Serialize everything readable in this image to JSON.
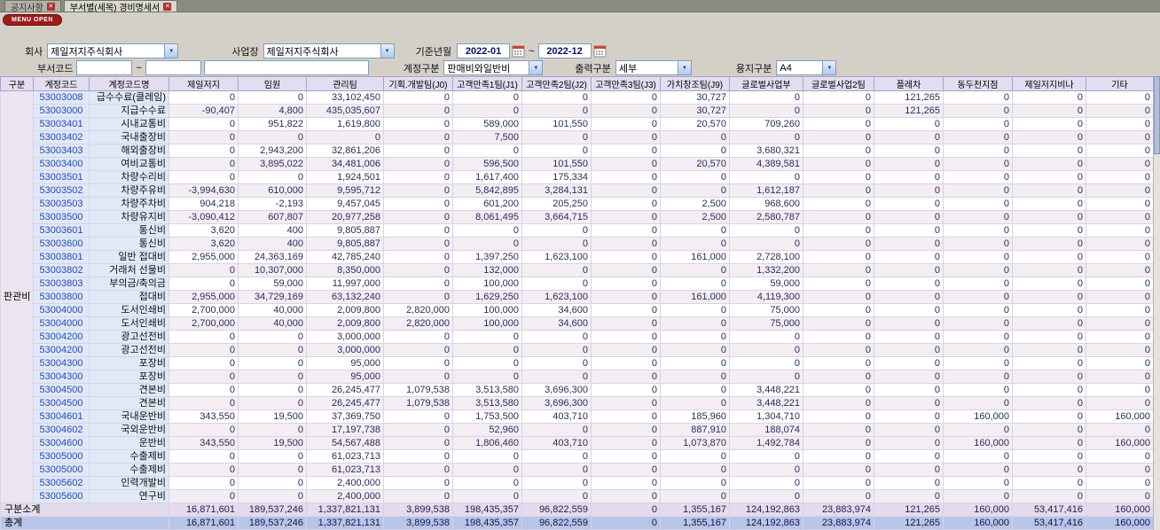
{
  "tabs": [
    {
      "label": "공지사항"
    },
    {
      "label": "부서별(세목) 경비명세서"
    }
  ],
  "menu_button": "MENU OPEN",
  "filters": {
    "company": {
      "label": "회사",
      "value": "제일저지주식회사"
    },
    "workplace": {
      "label": "사업장",
      "value": "제일저지주식회사"
    },
    "period": {
      "label": "기준년월",
      "from": "2022-01",
      "to": "2022-12",
      "separator": "~"
    },
    "dept_code": {
      "label": "부서코드",
      "value1": "",
      "value2": "",
      "value3": "",
      "separator": "~"
    },
    "account_type": {
      "label": "계정구분",
      "value": "판매비와일반비"
    },
    "output_type": {
      "label": "출력구분",
      "value": "세부"
    },
    "paper_type": {
      "label": "용지구분",
      "value": "A4"
    }
  },
  "grid": {
    "columns": [
      "구분",
      "계정코드",
      "계정코드명",
      "제일저지",
      "임원",
      "관리팀",
      "기획.개발팀(J0)",
      "고객만족1팀(J1)",
      "고객만족2팀(J2)",
      "고객만족3팀(J3)",
      "가치창조팀(J9)",
      "글로벌사업부",
      "글로벌사업2팀",
      "플레차",
      "동두천지점",
      "제일저지비나",
      "기타"
    ],
    "group_label": "판관비",
    "rows": [
      {
        "code": "53003008",
        "name": "급수수료(클레임)",
        "shade": "w",
        "values": [
          "0",
          "0",
          "33,102,450",
          "0",
          "0",
          "0",
          "0",
          "30,727",
          "0",
          "0",
          "121,265",
          "0",
          "0",
          "0"
        ]
      },
      {
        "code": "53003000",
        "name": "지급수수료",
        "shade": "p",
        "values": [
          "-90,407",
          "4,800",
          "435,035,607",
          "0",
          "0",
          "0",
          "0",
          "30,727",
          "0",
          "0",
          "121,265",
          "0",
          "0",
          "0"
        ]
      },
      {
        "code": "53003401",
        "name": "시내교통비",
        "shade": "w",
        "values": [
          "0",
          "951,822",
          "1,619,800",
          "0",
          "589,000",
          "101,550",
          "0",
          "20,570",
          "709,260",
          "0",
          "0",
          "0",
          "0",
          "0"
        ]
      },
      {
        "code": "53003402",
        "name": "국내출장비",
        "shade": "p",
        "values": [
          "0",
          "0",
          "0",
          "0",
          "7,500",
          "0",
          "0",
          "0",
          "0",
          "0",
          "0",
          "0",
          "0",
          "0"
        ]
      },
      {
        "code": "53003403",
        "name": "해외출장비",
        "shade": "w",
        "values": [
          "0",
          "2,943,200",
          "32,861,206",
          "0",
          "0",
          "0",
          "0",
          "0",
          "3,680,321",
          "0",
          "0",
          "0",
          "0",
          "0"
        ]
      },
      {
        "code": "53003400",
        "name": "여비교통비",
        "shade": "p",
        "values": [
          "0",
          "3,895,022",
          "34,481,006",
          "0",
          "596,500",
          "101,550",
          "0",
          "20,570",
          "4,389,581",
          "0",
          "0",
          "0",
          "0",
          "0"
        ]
      },
      {
        "code": "53003501",
        "name": "차량수리비",
        "shade": "w",
        "values": [
          "0",
          "0",
          "1,924,501",
          "0",
          "1,617,400",
          "175,334",
          "0",
          "0",
          "0",
          "0",
          "0",
          "0",
          "0",
          "0"
        ]
      },
      {
        "code": "53003502",
        "name": "차량주유비",
        "shade": "p",
        "values": [
          "-3,994,630",
          "610,000",
          "9,595,712",
          "0",
          "5,842,895",
          "3,284,131",
          "0",
          "0",
          "1,612,187",
          "0",
          "0",
          "0",
          "0",
          "0"
        ]
      },
      {
        "code": "53003503",
        "name": "차량주차비",
        "shade": "w",
        "values": [
          "904,218",
          "-2,193",
          "9,457,045",
          "0",
          "601,200",
          "205,250",
          "0",
          "2,500",
          "968,600",
          "0",
          "0",
          "0",
          "0",
          "0"
        ]
      },
      {
        "code": "53003500",
        "name": "차량유지비",
        "shade": "p",
        "values": [
          "-3,090,412",
          "607,807",
          "20,977,258",
          "0",
          "8,061,495",
          "3,664,715",
          "0",
          "2,500",
          "2,580,787",
          "0",
          "0",
          "0",
          "0",
          "0"
        ]
      },
      {
        "code": "53003601",
        "name": "통신비",
        "shade": "w",
        "values": [
          "3,620",
          "400",
          "9,805,887",
          "0",
          "0",
          "0",
          "0",
          "0",
          "0",
          "0",
          "0",
          "0",
          "0",
          "0"
        ]
      },
      {
        "code": "53003600",
        "name": "통신비",
        "shade": "p",
        "values": [
          "3,620",
          "400",
          "9,805,887",
          "0",
          "0",
          "0",
          "0",
          "0",
          "0",
          "0",
          "0",
          "0",
          "0",
          "0"
        ]
      },
      {
        "code": "53003801",
        "name": "일반 접대비",
        "shade": "w",
        "values": [
          "2,955,000",
          "24,363,169",
          "42,785,240",
          "0",
          "1,397,250",
          "1,623,100",
          "0",
          "161,000",
          "2,728,100",
          "0",
          "0",
          "0",
          "0",
          "0"
        ]
      },
      {
        "code": "53003802",
        "name": "거래처 선물비",
        "shade": "p",
        "values": [
          "0",
          "10,307,000",
          "8,350,000",
          "0",
          "132,000",
          "0",
          "0",
          "0",
          "1,332,200",
          "0",
          "0",
          "0",
          "0",
          "0"
        ]
      },
      {
        "code": "53003803",
        "name": "부의금/축의금",
        "shade": "w",
        "values": [
          "0",
          "59,000",
          "11,997,000",
          "0",
          "100,000",
          "0",
          "0",
          "0",
          "59,000",
          "0",
          "0",
          "0",
          "0",
          "0"
        ]
      },
      {
        "code": "53003800",
        "name": "접대비",
        "shade": "p",
        "values": [
          "2,955,000",
          "34,729,169",
          "63,132,240",
          "0",
          "1,629,250",
          "1,623,100",
          "0",
          "161,000",
          "4,119,300",
          "0",
          "0",
          "0",
          "0",
          "0"
        ]
      },
      {
        "code": "53004000",
        "name": "도서인쇄비",
        "shade": "w",
        "values": [
          "2,700,000",
          "40,000",
          "2,009,800",
          "2,820,000",
          "100,000",
          "34,600",
          "0",
          "0",
          "75,000",
          "0",
          "0",
          "0",
          "0",
          "0"
        ]
      },
      {
        "code": "53004000",
        "name": "도서인쇄비",
        "shade": "p",
        "values": [
          "2,700,000",
          "40,000",
          "2,009,800",
          "2,820,000",
          "100,000",
          "34,600",
          "0",
          "0",
          "75,000",
          "0",
          "0",
          "0",
          "0",
          "0"
        ]
      },
      {
        "code": "53004200",
        "name": "광고선전비",
        "shade": "w",
        "values": [
          "0",
          "0",
          "3,000,000",
          "0",
          "0",
          "0",
          "0",
          "0",
          "0",
          "0",
          "0",
          "0",
          "0",
          "0"
        ]
      },
      {
        "code": "53004200",
        "name": "광고선전비",
        "shade": "p",
        "values": [
          "0",
          "0",
          "3,000,000",
          "0",
          "0",
          "0",
          "0",
          "0",
          "0",
          "0",
          "0",
          "0",
          "0",
          "0"
        ]
      },
      {
        "code": "53004300",
        "name": "포장비",
        "shade": "w",
        "values": [
          "0",
          "0",
          "95,000",
          "0",
          "0",
          "0",
          "0",
          "0",
          "0",
          "0",
          "0",
          "0",
          "0",
          "0"
        ]
      },
      {
        "code": "53004300",
        "name": "포장비",
        "shade": "p",
        "values": [
          "0",
          "0",
          "95,000",
          "0",
          "0",
          "0",
          "0",
          "0",
          "0",
          "0",
          "0",
          "0",
          "0",
          "0"
        ]
      },
      {
        "code": "53004500",
        "name": "견본비",
        "shade": "w",
        "values": [
          "0",
          "0",
          "26,245,477",
          "1,079,538",
          "3,513,580",
          "3,696,300",
          "0",
          "0",
          "3,448,221",
          "0",
          "0",
          "0",
          "0",
          "0"
        ]
      },
      {
        "code": "53004500",
        "name": "견본비",
        "shade": "p",
        "values": [
          "0",
          "0",
          "26,245,477",
          "1,079,538",
          "3,513,580",
          "3,696,300",
          "0",
          "0",
          "3,448,221",
          "0",
          "0",
          "0",
          "0",
          "0"
        ]
      },
      {
        "code": "53004601",
        "name": "국내운반비",
        "shade": "w",
        "values": [
          "343,550",
          "19,500",
          "37,369,750",
          "0",
          "1,753,500",
          "403,710",
          "0",
          "185,960",
          "1,304,710",
          "0",
          "0",
          "160,000",
          "0",
          "160,000"
        ]
      },
      {
        "code": "53004602",
        "name": "국외운반비",
        "shade": "p",
        "values": [
          "0",
          "0",
          "17,197,738",
          "0",
          "52,960",
          "0",
          "0",
          "887,910",
          "188,074",
          "0",
          "0",
          "0",
          "0",
          "0"
        ]
      },
      {
        "code": "53004600",
        "name": "운반비",
        "shade": "p",
        "values": [
          "343,550",
          "19,500",
          "54,567,488",
          "0",
          "1,806,460",
          "403,710",
          "0",
          "1,073,870",
          "1,492,784",
          "0",
          "0",
          "160,000",
          "0",
          "160,000"
        ]
      },
      {
        "code": "53005000",
        "name": "수출제비",
        "shade": "w",
        "values": [
          "0",
          "0",
          "61,023,713",
          "0",
          "0",
          "0",
          "0",
          "0",
          "0",
          "0",
          "0",
          "0",
          "0",
          "0"
        ]
      },
      {
        "code": "53005000",
        "name": "수출제비",
        "shade": "p",
        "values": [
          "0",
          "0",
          "61,023,713",
          "0",
          "0",
          "0",
          "0",
          "0",
          "0",
          "0",
          "0",
          "0",
          "0",
          "0"
        ]
      },
      {
        "code": "53005602",
        "name": "인력개발비",
        "shade": "w",
        "values": [
          "0",
          "0",
          "2,400,000",
          "0",
          "0",
          "0",
          "0",
          "0",
          "0",
          "0",
          "0",
          "0",
          "0",
          "0"
        ]
      },
      {
        "code": "53005600",
        "name": "연구비",
        "shade": "p",
        "values": [
          "0",
          "0",
          "2,400,000",
          "0",
          "0",
          "0",
          "0",
          "0",
          "0",
          "0",
          "0",
          "0",
          "0",
          "0"
        ]
      }
    ],
    "subtotal": {
      "label": "구분소계",
      "values": [
        "16,871,601",
        "189,537,246",
        "1,337,821,131",
        "3,899,538",
        "198,435,357",
        "96,822,559",
        "0",
        "1,355,167",
        "124,192,863",
        "23,883,974",
        "121,265",
        "160,000",
        "53,417,416",
        "160,000"
      ]
    },
    "total": {
      "label": "총계",
      "values": [
        "16,871,601",
        "189,537,246",
        "1,337,821,131",
        "3,899,538",
        "198,435,357",
        "96,822,559",
        "0",
        "1,355,167",
        "124,192,863",
        "23,883,974",
        "121,265",
        "160,000",
        "53,417,416",
        "160,000"
      ]
    }
  }
}
